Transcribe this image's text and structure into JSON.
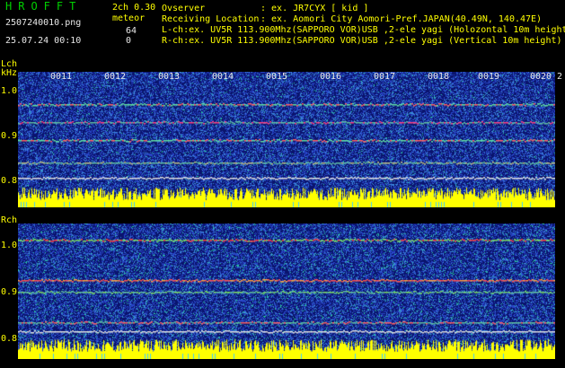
{
  "app": {
    "name": "HROFFT",
    "version": "2ch 0.30",
    "mode": "meteor",
    "filename": "2507240010.png",
    "datetime": "25.07.24 00:10",
    "lch_count": "64",
    "rch_count": "0"
  },
  "info": {
    "observer_label": "Ovserver",
    "observer_value": ": ex. JR7CYX [ kid ]",
    "location_label": "Receiving Location",
    "location_value": ": ex. Aomori City Aomori-Pref.JAPAN(40.49N, 140.47E)",
    "lch_line": "L-ch:ex. UV5R 113.900Mhz(SAPPORO VOR)USB ,2-ele yagi (Holozontal 10m height)",
    "rch_line": "R-ch:ex. UV5R 113.900Mhz(SAPPORO VOR)USB ,2-ele yagi (Vertical 10m height)"
  },
  "lch": {
    "title": "Lch",
    "unit": "kHz",
    "y_ticks": [
      "1.0",
      "0.9",
      "0.8"
    ],
    "time_ticks": [
      "0011",
      "0012",
      "0013",
      "0014",
      "0015",
      "0016",
      "0017",
      "0018",
      "0019",
      "0020",
      "2"
    ]
  },
  "rch": {
    "title": "Rch",
    "y_ticks": [
      "1.0",
      "0.9",
      "0.8"
    ]
  },
  "colors": {
    "background": "#000000",
    "label_yellow": "#ffff00",
    "text_white": "#e8e8e8",
    "app_green": "#00d000",
    "spectrum_base": "#1a2a9a",
    "noise_yellow": "#ffff00"
  }
}
